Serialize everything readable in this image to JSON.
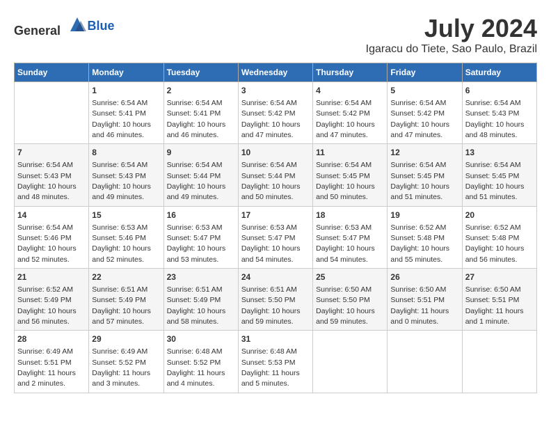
{
  "header": {
    "logo_general": "General",
    "logo_blue": "Blue",
    "title": "July 2024",
    "subtitle": "Igaracu do Tiete, Sao Paulo, Brazil"
  },
  "days_of_week": [
    "Sunday",
    "Monday",
    "Tuesday",
    "Wednesday",
    "Thursday",
    "Friday",
    "Saturday"
  ],
  "weeks": [
    [
      {
        "day": "",
        "info": ""
      },
      {
        "day": "1",
        "info": "Sunrise: 6:54 AM\nSunset: 5:41 PM\nDaylight: 10 hours\nand 46 minutes."
      },
      {
        "day": "2",
        "info": "Sunrise: 6:54 AM\nSunset: 5:41 PM\nDaylight: 10 hours\nand 46 minutes."
      },
      {
        "day": "3",
        "info": "Sunrise: 6:54 AM\nSunset: 5:42 PM\nDaylight: 10 hours\nand 47 minutes."
      },
      {
        "day": "4",
        "info": "Sunrise: 6:54 AM\nSunset: 5:42 PM\nDaylight: 10 hours\nand 47 minutes."
      },
      {
        "day": "5",
        "info": "Sunrise: 6:54 AM\nSunset: 5:42 PM\nDaylight: 10 hours\nand 47 minutes."
      },
      {
        "day": "6",
        "info": "Sunrise: 6:54 AM\nSunset: 5:43 PM\nDaylight: 10 hours\nand 48 minutes."
      }
    ],
    [
      {
        "day": "7",
        "info": "Sunrise: 6:54 AM\nSunset: 5:43 PM\nDaylight: 10 hours\nand 48 minutes."
      },
      {
        "day": "8",
        "info": "Sunrise: 6:54 AM\nSunset: 5:43 PM\nDaylight: 10 hours\nand 49 minutes."
      },
      {
        "day": "9",
        "info": "Sunrise: 6:54 AM\nSunset: 5:44 PM\nDaylight: 10 hours\nand 49 minutes."
      },
      {
        "day": "10",
        "info": "Sunrise: 6:54 AM\nSunset: 5:44 PM\nDaylight: 10 hours\nand 50 minutes."
      },
      {
        "day": "11",
        "info": "Sunrise: 6:54 AM\nSunset: 5:45 PM\nDaylight: 10 hours\nand 50 minutes."
      },
      {
        "day": "12",
        "info": "Sunrise: 6:54 AM\nSunset: 5:45 PM\nDaylight: 10 hours\nand 51 minutes."
      },
      {
        "day": "13",
        "info": "Sunrise: 6:54 AM\nSunset: 5:45 PM\nDaylight: 10 hours\nand 51 minutes."
      }
    ],
    [
      {
        "day": "14",
        "info": "Sunrise: 6:54 AM\nSunset: 5:46 PM\nDaylight: 10 hours\nand 52 minutes."
      },
      {
        "day": "15",
        "info": "Sunrise: 6:53 AM\nSunset: 5:46 PM\nDaylight: 10 hours\nand 52 minutes."
      },
      {
        "day": "16",
        "info": "Sunrise: 6:53 AM\nSunset: 5:47 PM\nDaylight: 10 hours\nand 53 minutes."
      },
      {
        "day": "17",
        "info": "Sunrise: 6:53 AM\nSunset: 5:47 PM\nDaylight: 10 hours\nand 54 minutes."
      },
      {
        "day": "18",
        "info": "Sunrise: 6:53 AM\nSunset: 5:47 PM\nDaylight: 10 hours\nand 54 minutes."
      },
      {
        "day": "19",
        "info": "Sunrise: 6:52 AM\nSunset: 5:48 PM\nDaylight: 10 hours\nand 55 minutes."
      },
      {
        "day": "20",
        "info": "Sunrise: 6:52 AM\nSunset: 5:48 PM\nDaylight: 10 hours\nand 56 minutes."
      }
    ],
    [
      {
        "day": "21",
        "info": "Sunrise: 6:52 AM\nSunset: 5:49 PM\nDaylight: 10 hours\nand 56 minutes."
      },
      {
        "day": "22",
        "info": "Sunrise: 6:51 AM\nSunset: 5:49 PM\nDaylight: 10 hours\nand 57 minutes."
      },
      {
        "day": "23",
        "info": "Sunrise: 6:51 AM\nSunset: 5:49 PM\nDaylight: 10 hours\nand 58 minutes."
      },
      {
        "day": "24",
        "info": "Sunrise: 6:51 AM\nSunset: 5:50 PM\nDaylight: 10 hours\nand 59 minutes."
      },
      {
        "day": "25",
        "info": "Sunrise: 6:50 AM\nSunset: 5:50 PM\nDaylight: 10 hours\nand 59 minutes."
      },
      {
        "day": "26",
        "info": "Sunrise: 6:50 AM\nSunset: 5:51 PM\nDaylight: 11 hours\nand 0 minutes."
      },
      {
        "day": "27",
        "info": "Sunrise: 6:50 AM\nSunset: 5:51 PM\nDaylight: 11 hours\nand 1 minute."
      }
    ],
    [
      {
        "day": "28",
        "info": "Sunrise: 6:49 AM\nSunset: 5:51 PM\nDaylight: 11 hours\nand 2 minutes."
      },
      {
        "day": "29",
        "info": "Sunrise: 6:49 AM\nSunset: 5:52 PM\nDaylight: 11 hours\nand 3 minutes."
      },
      {
        "day": "30",
        "info": "Sunrise: 6:48 AM\nSunset: 5:52 PM\nDaylight: 11 hours\nand 4 minutes."
      },
      {
        "day": "31",
        "info": "Sunrise: 6:48 AM\nSunset: 5:53 PM\nDaylight: 11 hours\nand 5 minutes."
      },
      {
        "day": "",
        "info": ""
      },
      {
        "day": "",
        "info": ""
      },
      {
        "day": "",
        "info": ""
      }
    ]
  ]
}
